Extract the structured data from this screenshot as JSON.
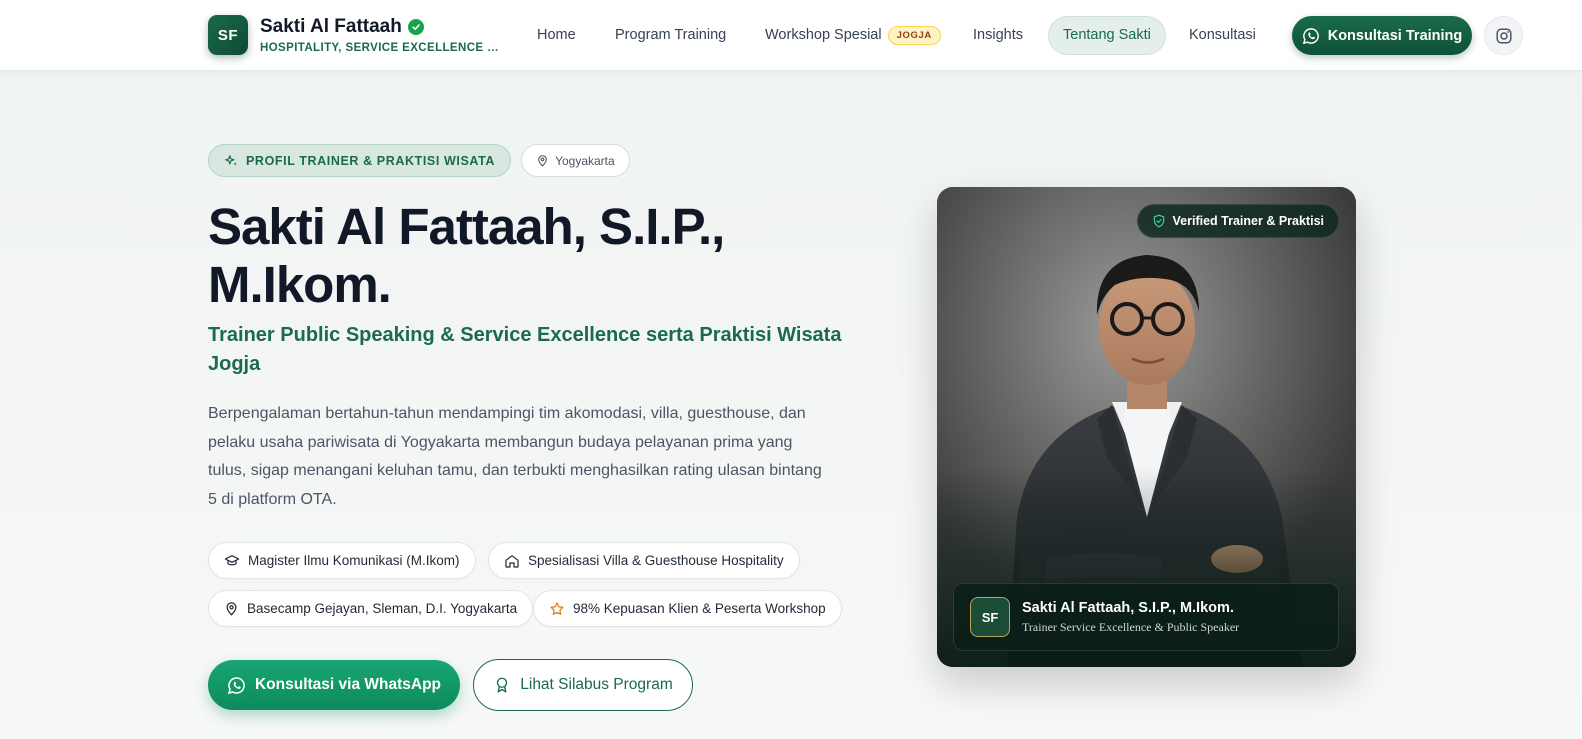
{
  "header": {
    "logo_initials": "SF",
    "brand_name": "Sakti Al Fattaah",
    "tagline": "HOSPITALITY, SERVICE EXCELLENCE & PUBLIC SPEAKING",
    "nav": [
      {
        "label": "Home"
      },
      {
        "label": "Program Training"
      },
      {
        "label": "Workshop Spesial",
        "badge": "JOGJA"
      },
      {
        "label": "Insights"
      },
      {
        "label": "Tentang Sakti",
        "active": true
      },
      {
        "label": "Konsultasi"
      }
    ],
    "cta_label": "Konsultasi Training",
    "instagram_icon": "instagram-icon"
  },
  "hero": {
    "eyebrow": "PROFIL TRAINER & PRAKTISI WISATA",
    "location_pill": "Yogyakarta",
    "title": "Sakti Al Fattaah, S.I.P., M.Ikom.",
    "subtitle": "Trainer Public Speaking & Service Excellence serta Praktisi Wisata Jogja",
    "description": "Berpengalaman bertahun-tahun mendampingi tim akomodasi, villa, guesthouse, dan pelaku usaha pariwisata di Yogyakarta membangun budaya pelayanan prima yang tulus, sigap menangani keluhan tamu, dan terbukti menghasilkan rating ulasan bintang 5 di platform OTA.",
    "chips": [
      {
        "icon": "graduation-cap-icon",
        "label": "Magister Ilmu Komunikasi (M.Ikom)"
      },
      {
        "icon": "home-icon",
        "label": "Spesialisasi Villa & Guesthouse Hospitality"
      },
      {
        "icon": "map-pin-icon",
        "label": "Basecamp Gejayan, Sleman, D.I. Yogyakarta"
      },
      {
        "icon": "star-icon",
        "label": "98% Kepuasan Klien & Peserta Workshop"
      }
    ],
    "primary_button": "Konsultasi via WhatsApp",
    "secondary_button": "Lihat Silabus Program"
  },
  "profile_card": {
    "verified_label": "Verified Trainer & Praktisi",
    "logo_initials": "SF",
    "name": "Sakti Al Fattaah, S.I.P., M.Ikom.",
    "role": "Trainer Service Excellence & Public Speaker"
  },
  "colors": {
    "brand_green": "#1b6b4a",
    "whatsapp_green": "#17a673",
    "badge_yellow": "#fef3c7",
    "title_dark": "#111827"
  }
}
